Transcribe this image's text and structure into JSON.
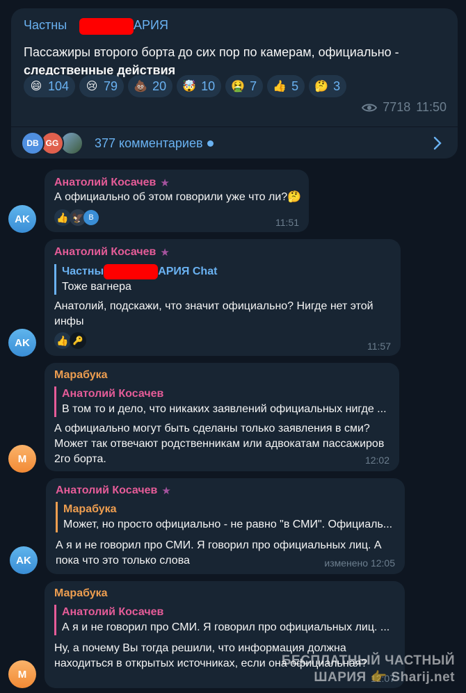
{
  "post": {
    "author_head": "Частны",
    "author_tail": "АРИЯ",
    "text_line1": "Пассажиры второго борта до сих пор по камерам, официально -",
    "text_bold": "следственные действия",
    "reactions": [
      {
        "emoji": "😄",
        "count": "104"
      },
      {
        "emoji": "😢",
        "count": "79"
      },
      {
        "emoji": "💩",
        "count": "20"
      },
      {
        "emoji": "🤯",
        "count": "10"
      },
      {
        "emoji": "🤮",
        "count": "7"
      },
      {
        "emoji": "👍",
        "count": "5"
      },
      {
        "emoji": "🤔",
        "count": "3"
      }
    ],
    "views": "7718",
    "time": "11:50",
    "comment_avatars": [
      "DB",
      "GG",
      ""
    ],
    "comments_label": "377 комментариев"
  },
  "messages": [
    {
      "avatar": "AK",
      "author": "Анатолий Косачев",
      "text": "А официально об этом говорили уже что ли?🤔",
      "reactions": [
        "👍",
        "🦅",
        "B"
      ],
      "time": "11:51"
    },
    {
      "avatar": "AK",
      "author": "Анатолий Косачев",
      "reply_name_head": "Частны",
      "reply_name_tail": "АРИЯ Chat",
      "reply_text": "Тоже вагнера",
      "text_line1": "Анатолий, подскажи, что значит официально? Нигде нет этой",
      "text_line2": "инфы",
      "reactions": [
        "👍",
        "🔑"
      ],
      "time": "11:57"
    },
    {
      "avatar": "M",
      "author": "Марабука",
      "reply_name": "Анатолий Косачев",
      "reply_text": "В том то и дело, что никаких заявлений официальных нигде ...",
      "text_line1": "А официально могут быть сделаны только заявления в сми?",
      "text_line2": "Может так отвечают родственникам или адвокатам пассажиров",
      "text_line3": "2го борта.",
      "time": "12:02"
    },
    {
      "avatar": "AK",
      "author": "Анатолий Косачев",
      "reply_name": "Марабука",
      "reply_text": "Может, но просто официально - не равно \"в СМИ\". Официаль...",
      "text_line1": "А я и не говорил про СМИ. Я говорил про официальных лиц. А",
      "text_line2": "пока что это только слова",
      "time": "изменено 12:05"
    },
    {
      "avatar": "M",
      "author": "Марабука",
      "reply_name": "Анатолий Косачев",
      "reply_text": "А я и не говорил про СМИ. Я говорил про официальных лиц. ...",
      "text_line1": "Ну, а почему Вы тогда решили, что информация должна",
      "text_line2": "находиться в открытых источниках, если она официальная?",
      "time": "12:07"
    }
  ],
  "watermark": {
    "line1": "БЕСПЛАТНЫЙ ЧАСТНЫЙ",
    "line2": "ШАРИЯ 👉 Sharij.net"
  },
  "colors": {
    "background": "#0e1621",
    "bubble": "#182533",
    "link": "#6ab2f2",
    "name_pink": "#e55c98",
    "name_orange": "#ee9e50",
    "redaction": "#ff0000"
  }
}
